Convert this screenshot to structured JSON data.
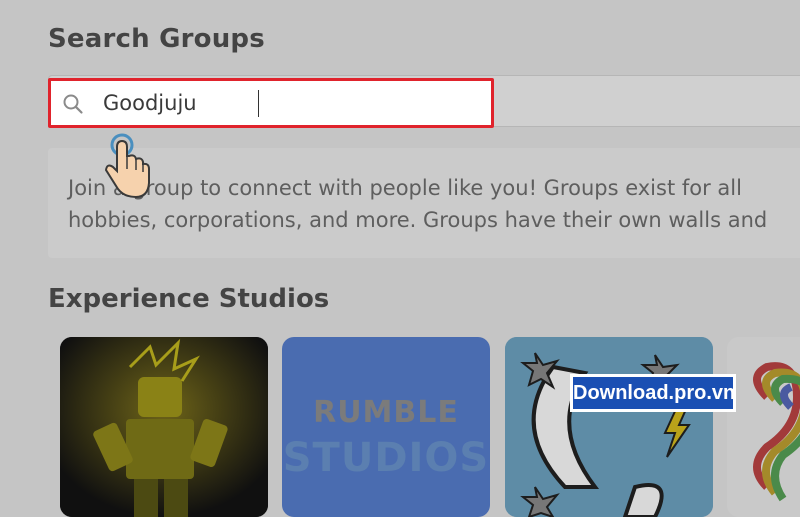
{
  "page": {
    "title": "Search Groups"
  },
  "search": {
    "value": "Goodjuju",
    "icon": "search-icon"
  },
  "info": {
    "line1": "Join a group to connect with people like you! Groups exist for all",
    "line2": "hobbies, corporations, and more. Groups have their own walls and"
  },
  "section": {
    "title": "Experience Studios"
  },
  "studios": [
    {
      "name": "Yellow avatar studio"
    },
    {
      "logo_line1": "RUMBLE",
      "logo_line2": "STUDIOS"
    },
    {
      "name": "Shuriken studio"
    },
    {
      "name": "Rainbow studio"
    }
  ],
  "watermark": {
    "text": "Download.pro.vn"
  },
  "colors": {
    "highlight": "#e0232c",
    "watermark_bg": "#1a4fb3",
    "overlay": "#c5c5c5"
  }
}
